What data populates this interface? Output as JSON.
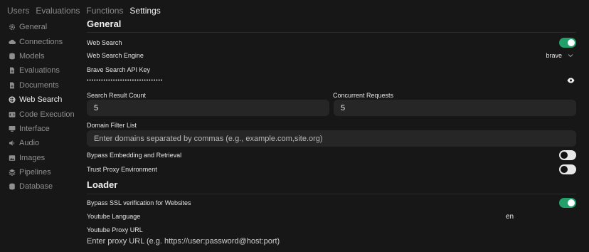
{
  "topnav": {
    "tabs": [
      "Users",
      "Evaluations",
      "Functions",
      "Settings"
    ]
  },
  "sidebar": {
    "items": [
      {
        "label": "General",
        "icon": "gear-icon"
      },
      {
        "label": "Connections",
        "icon": "cloud-icon"
      },
      {
        "label": "Models",
        "icon": "database-icon"
      },
      {
        "label": "Evaluations",
        "icon": "document-icon"
      },
      {
        "label": "Documents",
        "icon": "document-icon"
      },
      {
        "label": "Web Search",
        "icon": "globe-icon"
      },
      {
        "label": "Code Execution",
        "icon": "code-icon"
      },
      {
        "label": "Interface",
        "icon": "monitor-icon"
      },
      {
        "label": "Audio",
        "icon": "speaker-icon"
      },
      {
        "label": "Images",
        "icon": "image-icon"
      },
      {
        "label": "Pipelines",
        "icon": "layers-icon"
      },
      {
        "label": "Database",
        "icon": "database-icon"
      }
    ]
  },
  "general": {
    "heading": "General",
    "web_search_label": "Web Search",
    "web_search_enabled": true,
    "engine_label": "Web Search Engine",
    "engine_value": "brave",
    "api_key_label": "Brave Search API Key",
    "api_key_masked": "••••••••••••••••••••••••••••••••",
    "result_count_label": "Search Result Count",
    "result_count_value": "5",
    "concurrent_label": "Concurrent Requests",
    "concurrent_value": "5",
    "domain_filter_label": "Domain Filter List",
    "domain_filter_placeholder": "Enter domains separated by commas (e.g., example.com,site.org)",
    "bypass_embedding_label": "Bypass Embedding and Retrieval",
    "bypass_embedding_enabled": false,
    "trust_proxy_label": "Trust Proxy Environment",
    "trust_proxy_enabled": false
  },
  "loader": {
    "heading": "Loader",
    "bypass_ssl_label": "Bypass SSL verification for Websites",
    "bypass_ssl_enabled": true,
    "youtube_language_label": "Youtube Language",
    "youtube_language_value": "en",
    "youtube_proxy_label": "Youtube Proxy URL",
    "youtube_proxy_placeholder": "Enter proxy URL (e.g. https://user:password@host:port)"
  },
  "colors": {
    "toggle_on": "#22a06b",
    "background": "#171717",
    "field": "#262626"
  }
}
